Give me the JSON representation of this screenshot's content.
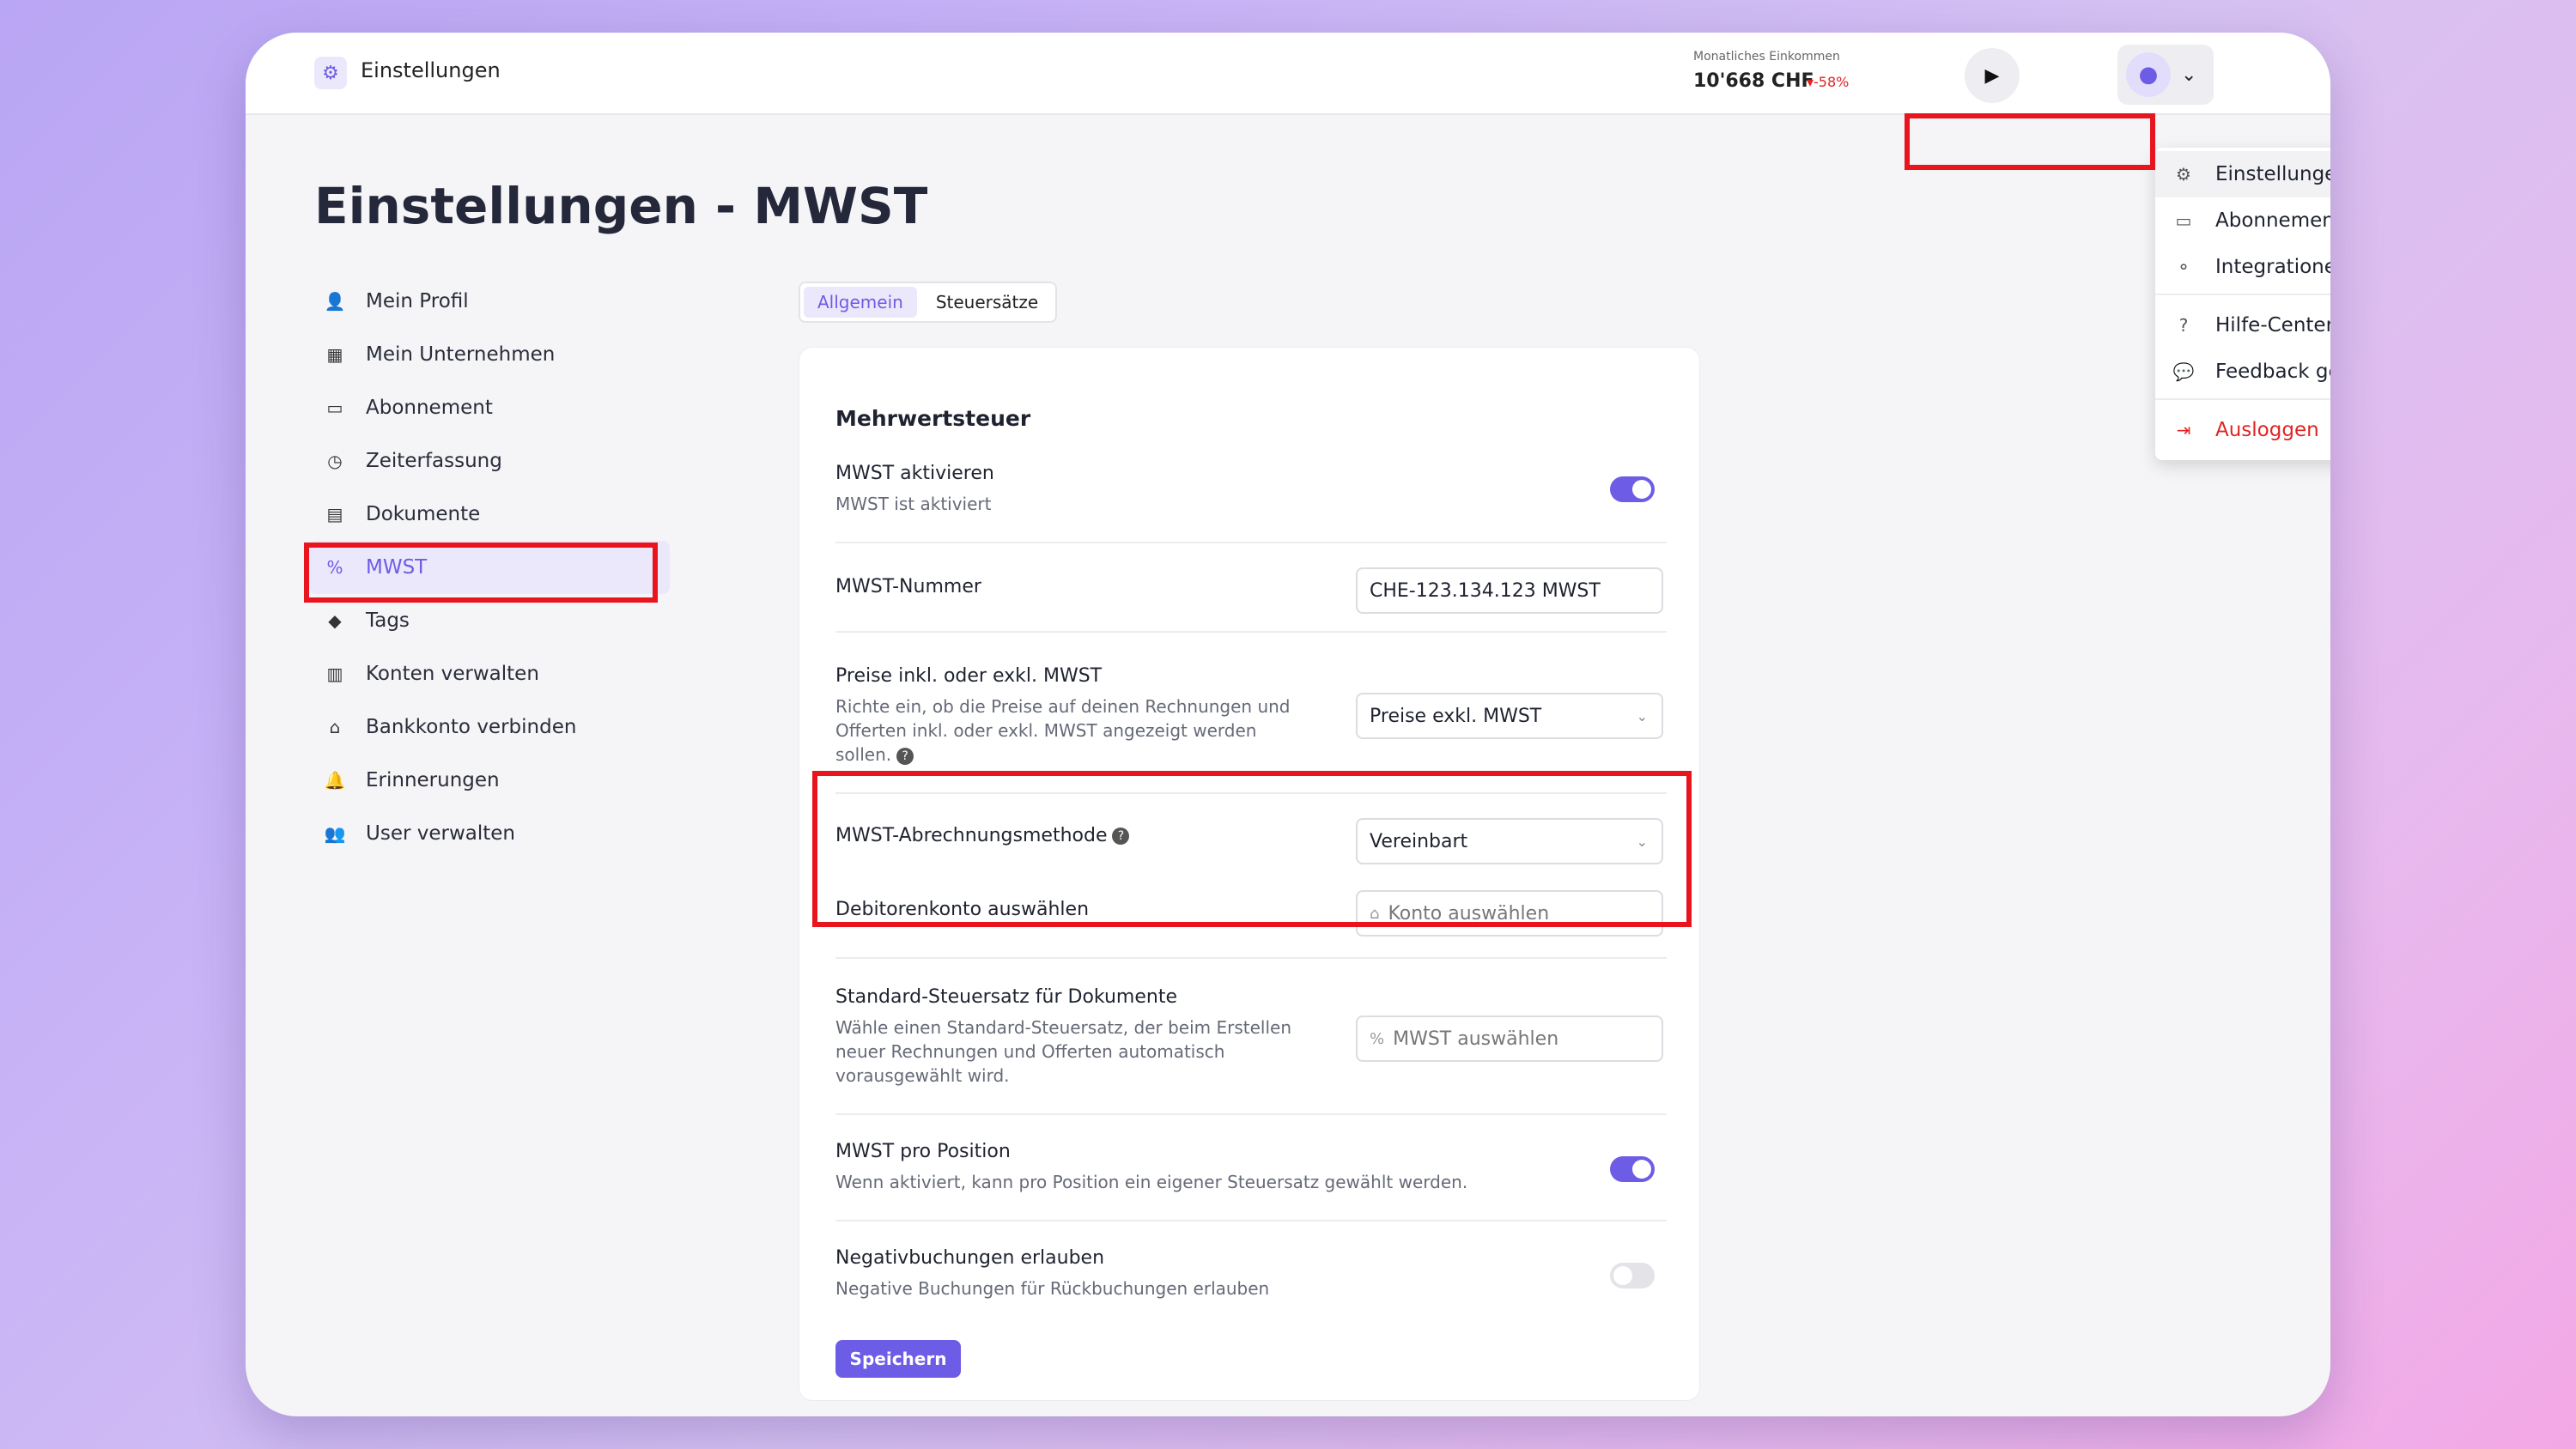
{
  "topbar": {
    "app_title": "Einstellungen",
    "income_label": "Monatliches Einkommen",
    "income_value": "10'668 CHF",
    "income_change": "-58%"
  },
  "page": {
    "title": "Einstellungen - MWST"
  },
  "sidebar": {
    "items": [
      {
        "label": "Mein Profil",
        "icon": "user-icon"
      },
      {
        "label": "Mein Unternehmen",
        "icon": "building-icon"
      },
      {
        "label": "Abonnement",
        "icon": "credit-card-icon"
      },
      {
        "label": "Zeiterfassung",
        "icon": "clock-icon"
      },
      {
        "label": "Dokumente",
        "icon": "document-icon"
      },
      {
        "label": "MWST",
        "icon": "percent-icon",
        "active": true
      },
      {
        "label": "Tags",
        "icon": "tag-icon"
      },
      {
        "label": "Konten verwalten",
        "icon": "ledger-icon"
      },
      {
        "label": "Bankkonto verbinden",
        "icon": "bank-icon"
      },
      {
        "label": "Erinnerungen",
        "icon": "bell-icon"
      },
      {
        "label": "User verwalten",
        "icon": "users-icon"
      }
    ]
  },
  "tabs": [
    {
      "label": "Allgemein",
      "active": true
    },
    {
      "label": "Steuersätze",
      "active": false
    }
  ],
  "card": {
    "title": "Mehrwertsteuer",
    "vat_enable": {
      "label": "MWST aktivieren",
      "sub": "MWST ist aktiviert",
      "on": true
    },
    "vat_number": {
      "label": "MWST-Nummer",
      "value": "CHE-123.134.123 MWST"
    },
    "prices": {
      "label": "Preise inkl. oder exkl. MWST",
      "sub": "Richte ein, ob die Preise auf deinen Rechnungen und Offerten inkl. oder exkl. MWST angezeigt werden sollen.",
      "value": "Preise exkl. MWST"
    },
    "method": {
      "label": "MWST-Abrechnungsmethode",
      "value": "Vereinbart"
    },
    "debtor": {
      "label": "Debitorenkonto auswählen",
      "placeholder": "Konto auswählen"
    },
    "default_rate": {
      "label": "Standard-Steuersatz für Dokumente",
      "sub": "Wähle einen Standard-Steuersatz, der beim Erstellen neuer Rechnungen und Offerten automatisch vorausgewählt wird.",
      "placeholder": "MWST auswählen"
    },
    "per_position": {
      "label": "MWST pro Position",
      "sub": "Wenn aktiviert, kann pro Position ein eigener Steuersatz gewählt werden.",
      "on": true
    },
    "negative": {
      "label": "Negativbuchungen erlauben",
      "sub": "Negative Buchungen für Rückbuchungen erlauben",
      "on": false
    },
    "save_label": "Speichern"
  },
  "dropdown": {
    "items": [
      {
        "label": "Einstellungen",
        "icon": "gear-icon"
      },
      {
        "label": "Abonnement",
        "icon": "credit-card-icon"
      },
      {
        "label": "Integrationen",
        "icon": "integrations-icon"
      },
      {
        "label": "Hilfe-Center",
        "icon": "help-icon"
      },
      {
        "label": "Feedback geben",
        "icon": "chat-icon"
      },
      {
        "label": "Ausloggen",
        "icon": "logout-icon"
      }
    ]
  },
  "colors": {
    "accent": "#6d5ce6",
    "highlight": "#e8141e",
    "negative": "#e02424"
  }
}
